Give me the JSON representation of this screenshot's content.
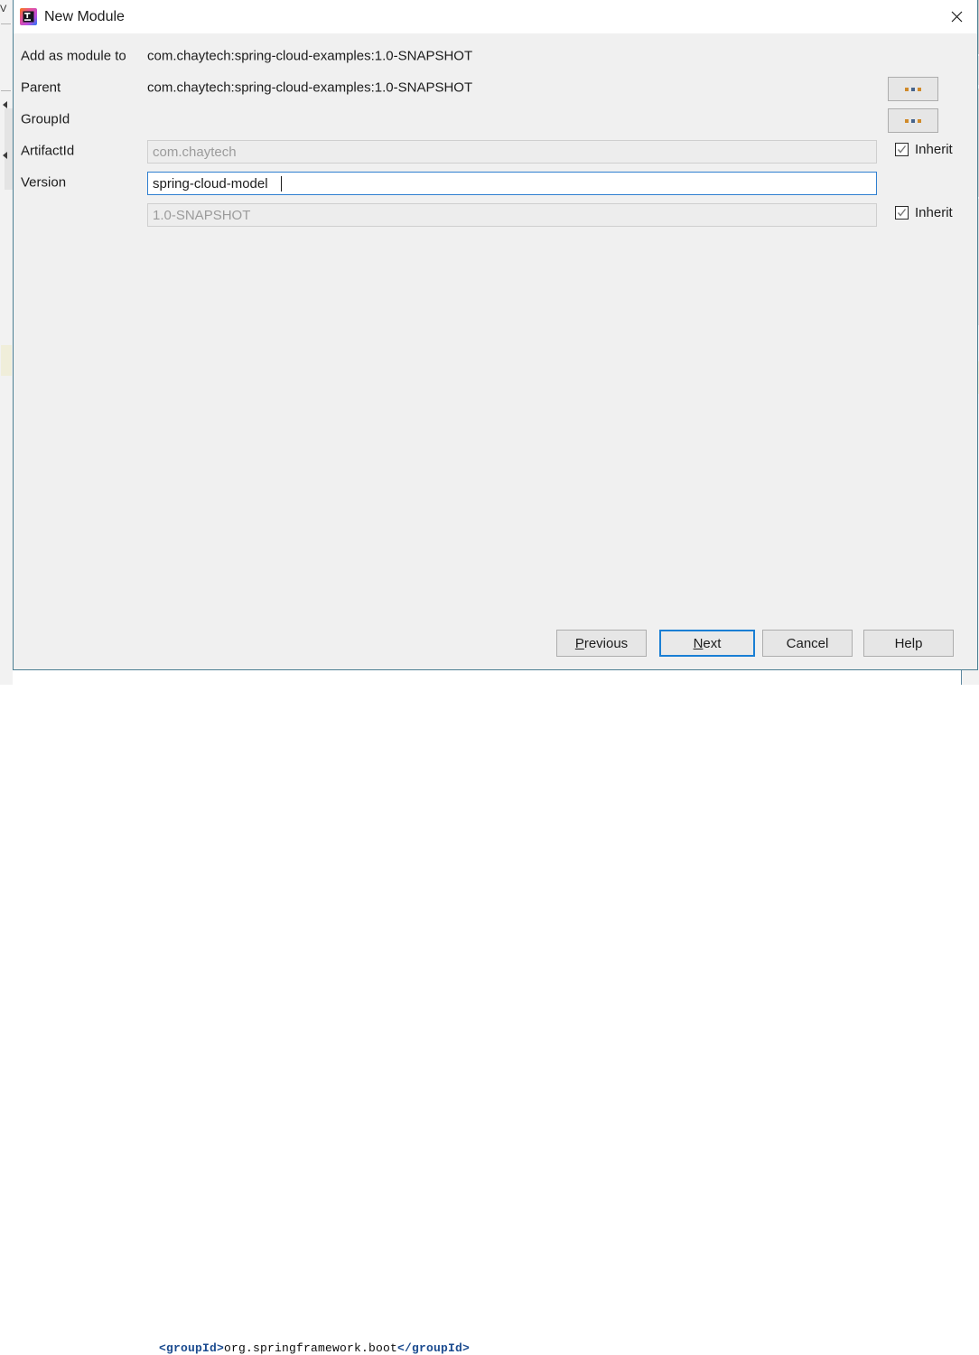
{
  "dialog": {
    "title": "New Module",
    "icon": "intellij-idea-icon",
    "close_label": "close-icon"
  },
  "form": {
    "rows": [
      {
        "label": "Add as module to",
        "value": "com.chaytech:spring-cloud-examples:1.0-SNAPSHOT",
        "type": "text",
        "browse": "..."
      },
      {
        "label": "Parent",
        "value": "com.chaytech:spring-cloud-examples:1.0-SNAPSHOT",
        "type": "text",
        "browse": "..."
      },
      {
        "label": "GroupId",
        "value": "com.chaytech",
        "type": "input",
        "enabled": false,
        "inherit": "Inherit",
        "inherit_checked": true
      },
      {
        "label": "ArtifactId",
        "value": "spring-cloud-model",
        "type": "input",
        "enabled": true,
        "focused": true
      },
      {
        "label": "Version",
        "value": "1.0-SNAPSHOT",
        "type": "input",
        "enabled": false,
        "inherit": "Inherit",
        "inherit_checked": true
      }
    ]
  },
  "buttons": {
    "previous": {
      "label": "Previous",
      "mnemonic": "P"
    },
    "next": {
      "label": "Next",
      "mnemonic": "N",
      "focused": true
    },
    "cancel": {
      "label": "Cancel"
    },
    "help": {
      "label": "Help"
    }
  },
  "ide_background": {
    "left_tab_label": "V",
    "code_line": "<groupId>org.springframework.boot</groupId>",
    "code_open_tag": "<groupId>",
    "code_text": "org.springframework.boot",
    "code_close_tag": "</groupId>"
  },
  "colors": {
    "dialog_border": "#4c7f93",
    "focus_blue": "#1a7fd4",
    "input_focus_border": "#2f7fd0",
    "dialog_bg": "#f0f0f0",
    "titlebar_bg": "#ffffff",
    "disabled_text": "#9b9b9b"
  }
}
